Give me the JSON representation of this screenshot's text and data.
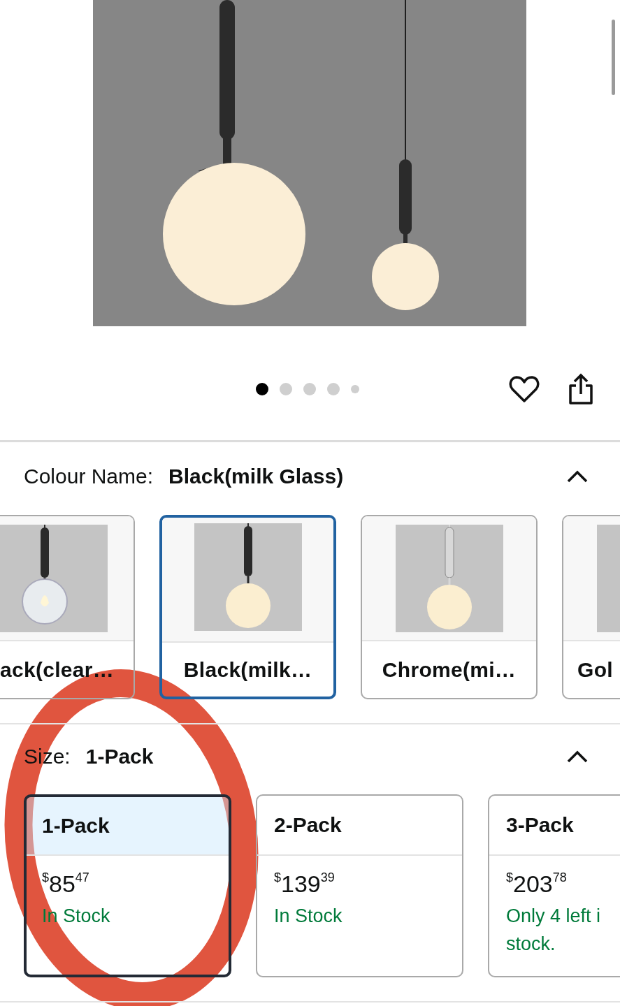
{
  "gallery": {
    "dots": [
      {
        "selected": true
      },
      {
        "selected": false
      },
      {
        "selected": false
      },
      {
        "selected": false
      },
      {
        "selected": false
      }
    ]
  },
  "colour": {
    "label": "Colour Name:",
    "value": "Black(milk Glass)",
    "expanded": true,
    "swatches": [
      {
        "label": "ack(clear…",
        "kind": "black-clear",
        "selected": false
      },
      {
        "label": "Black(milk…",
        "kind": "black-milk",
        "selected": true
      },
      {
        "label": "Chrome(mi…",
        "kind": "chrome-milk",
        "selected": false
      },
      {
        "label": "Gol",
        "kind": "gold",
        "selected": false
      }
    ]
  },
  "size": {
    "label": "Size:",
    "value": "1-Pack",
    "expanded": true,
    "options": [
      {
        "label": "1-Pack",
        "currency": "$",
        "price_whole": "85",
        "price_fraction": "47",
        "stock": "In Stock",
        "selected": true
      },
      {
        "label": "2-Pack",
        "currency": "$",
        "price_whole": "139",
        "price_fraction": "39",
        "stock": "In Stock",
        "selected": false
      },
      {
        "label": "3-Pack",
        "currency": "$",
        "price_whole": "203",
        "price_fraction": "78",
        "stock": "Only 4 left i\nstock.",
        "selected": false
      }
    ]
  }
}
